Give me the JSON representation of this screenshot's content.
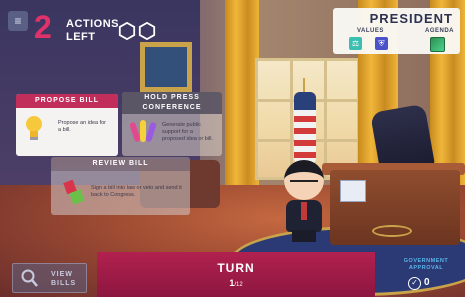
{
  "hud": {
    "menu_icon": "≡",
    "actions_left": "2",
    "actions_label_line1": "ACTIONS",
    "actions_label_line2": "LEFT",
    "action_tokens": 2
  },
  "president": {
    "title": "PRESIDENT",
    "values_label": "VALUES",
    "agenda_label": "AGENDA",
    "value_icons": [
      {
        "name": "scale-icon",
        "color": "#3bbfb0"
      },
      {
        "name": "shield-icon",
        "color": "#4a52c9"
      }
    ],
    "agenda_icon": "map-icon"
  },
  "cards": {
    "propose": {
      "title": "PROPOSE BILL",
      "text": "Propose an idea for a bill.",
      "icon": "lightbulb-icon"
    },
    "hold_press": {
      "title_line1": "HOLD PRESS",
      "title_line2": "CONFERENCE",
      "text": "Generate public support for a proposed idea or bill.",
      "icon": "microphones-icon"
    },
    "review": {
      "title": "REVIEW BILL",
      "text": "Sign a bill into law or veto and send it back to Congress.",
      "icon": "veto-stamp-icon"
    }
  },
  "bottom": {
    "view_bills_line1": "VIEW",
    "view_bills_line2": "BILLS",
    "turn_label": "TURN",
    "turn_current": "1",
    "turn_total": "/12",
    "approval_line1": "GOVERNMENT",
    "approval_line2": "APPROVAL",
    "approval_value": "0"
  },
  "colors": {
    "accent_pink": "#c22e5b",
    "turn_bar": "#b2214f",
    "actions_count": "#e0316a",
    "approval_blue": "#58b4e8"
  }
}
